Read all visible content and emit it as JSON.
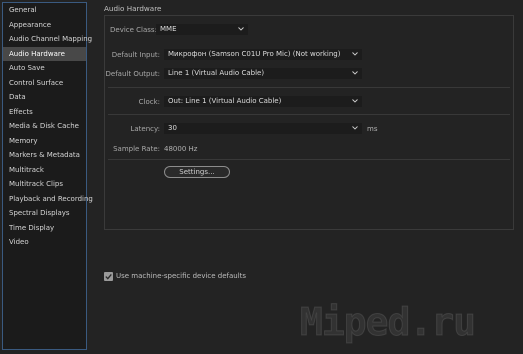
{
  "sidebar": {
    "items": [
      {
        "label": "General"
      },
      {
        "label": "Appearance"
      },
      {
        "label": "Audio Channel Mapping"
      },
      {
        "label": "Audio Hardware",
        "selected": true
      },
      {
        "label": "Auto Save"
      },
      {
        "label": "Control Surface"
      },
      {
        "label": "Data"
      },
      {
        "label": "Effects"
      },
      {
        "label": "Media & Disk Cache"
      },
      {
        "label": "Memory"
      },
      {
        "label": "Markers & Metadata"
      },
      {
        "label": "Multitrack"
      },
      {
        "label": "Multitrack Clips"
      },
      {
        "label": "Playback and Recording"
      },
      {
        "label": "Spectral Displays"
      },
      {
        "label": "Time Display"
      },
      {
        "label": "Video"
      }
    ]
  },
  "panel": {
    "title": "Audio Hardware",
    "device_class": {
      "label": "Device Class:",
      "value": "MME"
    },
    "default_input": {
      "label": "Default Input:",
      "value": "Микрофон (Samson C01U Pro Mic) (Not working)"
    },
    "default_output": {
      "label": "Default Output:",
      "value": "Line 1 (Virtual Audio Cable)"
    },
    "clock": {
      "label": "Clock:",
      "value": "Out: Line 1 (Virtual Audio Cable)"
    },
    "latency": {
      "label": "Latency:",
      "value": "30",
      "unit": "ms"
    },
    "sample_rate": {
      "label": "Sample Rate:",
      "value": "48000 Hz"
    },
    "settings_button": "Settings...",
    "machine_defaults": {
      "label": "Use machine-specific device defaults",
      "checked": true
    }
  },
  "watermark": "Miped.ru",
  "colors": {
    "selected_bg": "#484848",
    "sidebar_border": "#3a5a80",
    "background": "#232323"
  }
}
